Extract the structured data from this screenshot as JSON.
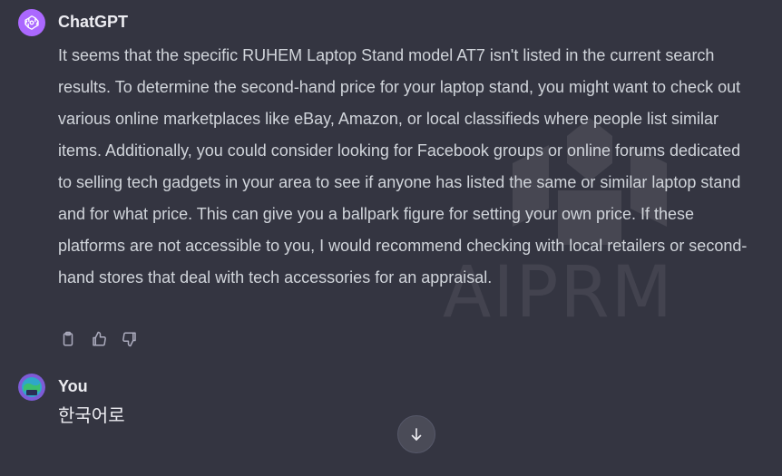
{
  "watermark": {
    "text": "AIPRM"
  },
  "conversation": {
    "assistant": {
      "author": "ChatGPT",
      "avatar_icon": "openai-logo-icon",
      "text": "It seems that the specific RUHEM Laptop Stand model AT7 isn't listed in the current search results. To determine the second-hand price for your laptop stand, you might want to check out various online marketplaces like eBay, Amazon, or local classifieds where people list similar items. Additionally, you could consider looking for Facebook groups or online forums dedicated to selling tech gadgets in your area to see if anyone has listed the same or similar laptop stand and for what price. This can give you a ballpark figure for setting your own price. If these platforms are not accessible to you, I would recommend checking with local retailers or second-hand stores that deal with tech accessories for an appraisal.",
      "actions": [
        "copy-icon",
        "thumbs-up-icon",
        "thumbs-down-icon"
      ]
    },
    "user": {
      "author": "You",
      "text": "한국어로"
    }
  },
  "scroll_button": {
    "icon": "arrow-down-icon"
  },
  "colors": {
    "background": "#343541",
    "avatar_accent": "#ab68ff",
    "text_primary": "#ececf1",
    "text_secondary": "#d1d5db"
  }
}
